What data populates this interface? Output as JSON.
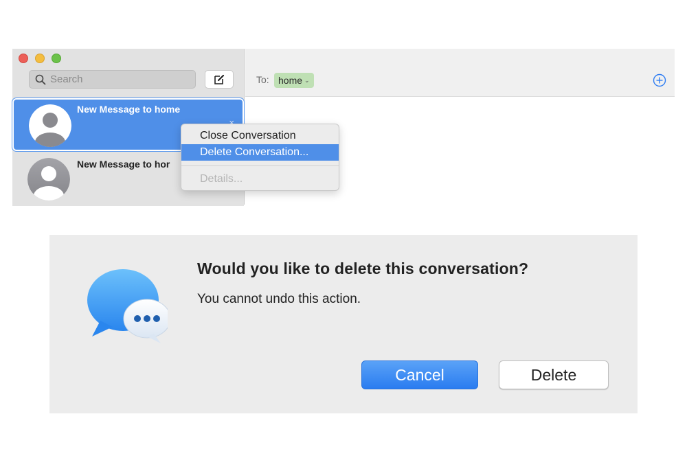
{
  "messages_window": {
    "window_controls": [
      "close",
      "minimize",
      "maximize"
    ],
    "search": {
      "placeholder": "Search",
      "value": ""
    },
    "compose_icon": "compose-icon",
    "conversations": [
      {
        "title": "New Message to home",
        "selected": true,
        "close_glyph": "×"
      },
      {
        "title": "New Message to hor",
        "selected": false
      }
    ],
    "header": {
      "to_label": "To:",
      "recipient": "home",
      "recipient_chevron": "⌄",
      "recipient_color": "#bfe0b4",
      "add_icon": "plus-circle-icon"
    },
    "context_menu": {
      "items": [
        {
          "label": "Close Conversation",
          "state": "normal"
        },
        {
          "label": "Delete Conversation...",
          "state": "highlighted"
        },
        {
          "label": "Details...",
          "state": "disabled"
        }
      ]
    }
  },
  "alert_dialog": {
    "icon": "messages-app-icon",
    "title": "Would you like to delete this conversation?",
    "message": "You cannot undo this action.",
    "buttons": {
      "cancel": "Cancel",
      "delete": "Delete"
    },
    "accent_color": "#2a7cf0"
  }
}
